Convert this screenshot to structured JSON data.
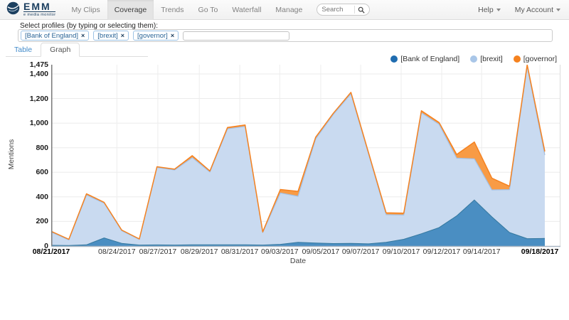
{
  "navbar": {
    "logo": {
      "title": "EMM",
      "subtitle": "e media monitor"
    },
    "items": [
      {
        "label": "My Clips",
        "active": false
      },
      {
        "label": "Coverage",
        "active": true
      },
      {
        "label": "Trends",
        "active": false
      },
      {
        "label": "Go To",
        "active": false
      },
      {
        "label": "Waterfall",
        "active": false
      },
      {
        "label": "Manage",
        "active": false
      }
    ],
    "search_placeholder": "Search",
    "right_items": [
      "Help",
      "My Account"
    ]
  },
  "profile_selector": {
    "label": "Select profiles (by typing or selecting them):",
    "chips": [
      "[Bank of England]",
      "[brexit]",
      "[governor]"
    ],
    "remove_icon": "×",
    "input_value": ""
  },
  "tabs": [
    {
      "label": "Table",
      "active": false
    },
    {
      "label": "Graph",
      "active": true
    }
  ],
  "chart_data": {
    "type": "area",
    "stacked": true,
    "title": "",
    "xlabel": "Date",
    "ylabel": "Mentions",
    "ylim": [
      0,
      1475
    ],
    "grid": true,
    "legend_position": "top-right",
    "x": [
      "08/21/2017",
      "08/22/2017",
      "08/23/2017",
      "08/24/2017",
      "08/25/2017",
      "08/26/2017",
      "08/27/2017",
      "08/28/2017",
      "08/29/2017",
      "08/30/2017",
      "08/31/2017",
      "09/01/2017",
      "09/02/2017",
      "09/03/2017",
      "09/04/2017",
      "09/05/2017",
      "09/06/2017",
      "09/07/2017",
      "09/08/2017",
      "09/09/2017",
      "09/10/2017",
      "09/11/2017",
      "09/12/2017",
      "09/13/2017",
      "09/14/2017",
      "09/15/2017",
      "09/16/2017",
      "09/17/2017",
      "09/18/2017"
    ],
    "series": [
      {
        "name": "[Bank of England]",
        "color": "#1f6cb0",
        "fill": "#4a8ec2",
        "line": "#34789f",
        "values": [
          6,
          4,
          10,
          66,
          22,
          8,
          9,
          8,
          10,
          10,
          10,
          10,
          8,
          14,
          30,
          25,
          20,
          22,
          18,
          30,
          55,
          100,
          150,
          245,
          375,
          237,
          110,
          60,
          62
        ]
      },
      {
        "name": "[brexit]",
        "color": "#a9c6e8",
        "fill": "#c9daf0",
        "line": "#a2bfe3",
        "values": [
          108,
          46,
          405,
          283,
          103,
          46,
          630,
          611,
          709,
          592,
          943,
          963,
          102,
          418,
          375,
          846,
          1050,
          1216,
          732,
          225,
          198,
          984,
          840,
          470,
          335,
          220,
          349,
          1400,
          678
        ]
      },
      {
        "name": "[governor]",
        "color": "#f5821f",
        "fill": "#f89b45",
        "line": "#f58220",
        "values": [
          6,
          5,
          10,
          6,
          5,
          4,
          6,
          6,
          16,
          8,
          12,
          12,
          5,
          28,
          40,
          14,
          10,
          12,
          10,
          15,
          15,
          16,
          15,
          30,
          136,
          95,
          28,
          15,
          30
        ]
      }
    ],
    "yticks": [
      {
        "v": 0,
        "label": "0"
      },
      {
        "v": 200,
        "label": "200"
      },
      {
        "v": 400,
        "label": "400"
      },
      {
        "v": 600,
        "label": "600"
      },
      {
        "v": 800,
        "label": "800"
      },
      {
        "v": 1000,
        "label": "1,000"
      },
      {
        "v": 1200,
        "label": "1,200"
      },
      {
        "v": 1400,
        "label": "1,400"
      },
      {
        "v": 1475,
        "label": "1,475"
      }
    ],
    "xticks": [
      {
        "label": "08/21/2017",
        "frac": 0.0,
        "bold": true
      },
      {
        "label": "08/24/2017",
        "frac": 0.133,
        "bold": false
      },
      {
        "label": "08/27/2017",
        "frac": 0.216,
        "bold": false
      },
      {
        "label": "08/29/2017",
        "frac": 0.3,
        "bold": false
      },
      {
        "label": "08/31/2017",
        "frac": 0.382,
        "bold": false
      },
      {
        "label": "09/03/2017",
        "frac": 0.463,
        "bold": false
      },
      {
        "label": "09/05/2017",
        "frac": 0.546,
        "bold": false
      },
      {
        "label": "09/07/2017",
        "frac": 0.627,
        "bold": false
      },
      {
        "label": "09/10/2017",
        "frac": 0.709,
        "bold": false
      },
      {
        "label": "09/12/2017",
        "frac": 0.791,
        "bold": false
      },
      {
        "label": "09/14/2017",
        "frac": 0.872,
        "bold": false
      },
      {
        "label": "09/18/2017",
        "frac": 0.99,
        "bold": true
      }
    ]
  }
}
